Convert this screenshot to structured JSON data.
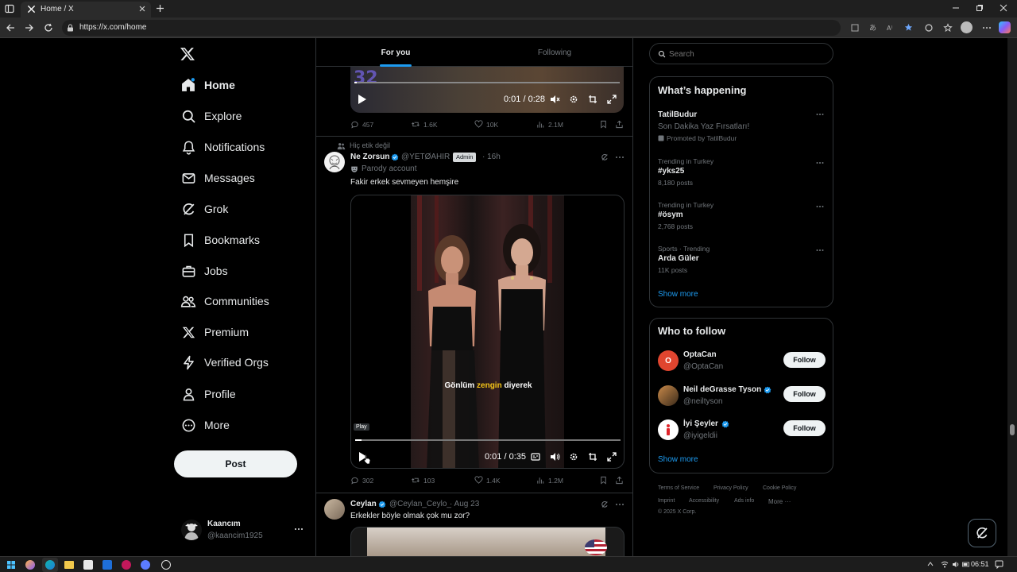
{
  "browser": {
    "tab_title": "Home / X",
    "url": "https://x.com/home"
  },
  "nav": {
    "items": [
      {
        "label": "Home",
        "icon": "home-icon",
        "active": true
      },
      {
        "label": "Explore",
        "icon": "search-icon"
      },
      {
        "label": "Notifications",
        "icon": "bell-icon"
      },
      {
        "label": "Messages",
        "icon": "envelope-icon"
      },
      {
        "label": "Grok",
        "icon": "grok-icon"
      },
      {
        "label": "Bookmarks",
        "icon": "bookmark-icon"
      },
      {
        "label": "Jobs",
        "icon": "briefcase-icon"
      },
      {
        "label": "Communities",
        "icon": "people-icon"
      },
      {
        "label": "Premium",
        "icon": "x-logo-icon"
      },
      {
        "label": "Verified Orgs",
        "icon": "lightning-icon"
      },
      {
        "label": "Profile",
        "icon": "person-icon"
      },
      {
        "label": "More",
        "icon": "more-circle-icon"
      }
    ],
    "post_label": "Post",
    "account": {
      "name": "Kaancım",
      "handle": "@kaancim1925"
    }
  },
  "feed": {
    "tabs": [
      {
        "label": "For you",
        "active": true
      },
      {
        "label": "Following",
        "active": false
      }
    ],
    "tweet0": {
      "video_watermark": "32",
      "time": "0:01 / 0:28",
      "replies": "457",
      "reposts": "1.6K",
      "likes": "10K",
      "views": "2.1M"
    },
    "tweet1": {
      "social_context": "Hiç etik değil",
      "name": "Ne Zorsun",
      "handle": "@YETØAHIR",
      "badge": "Admin",
      "ago": "· 16h",
      "parody": "Parody account",
      "text": "Fakir erkek sevmeyen hemşire",
      "subtitle_a": "Gönlüm ",
      "subtitle_b": "zengin",
      "subtitle_c": " diyerek",
      "tooltip": "Play",
      "time": "0:01 / 0:35",
      "replies": "302",
      "reposts": "103",
      "likes": "1.4K",
      "views": "1.2M"
    },
    "tweet2": {
      "name": "Ceylan",
      "handle": "@Ceylan_Ceylo_",
      "ago": "· Aug 23",
      "text": "Erkekler böyle olmak çok mu zor?"
    }
  },
  "right": {
    "search_placeholder": "Search",
    "happening": {
      "title": "What’s happening",
      "trends": [
        {
          "title": "TatilBudur",
          "sub": "Son Dakika Yaz Fırsatları!",
          "meta": "Promoted by TatilBudur"
        },
        {
          "meta": "Trending in Turkey",
          "title": "#yks25",
          "posts": "8,180 posts"
        },
        {
          "meta": "Trending in Turkey",
          "title": "#ösym",
          "posts": "2,768 posts"
        },
        {
          "meta": "Sports · Trending",
          "title": "Arda Güler",
          "posts": "11K posts"
        }
      ],
      "show_more": "Show more"
    },
    "who": {
      "title": "Who to follow",
      "users": [
        {
          "name": "OptaCan",
          "handle": "@OptaCan"
        },
        {
          "name": "Neil deGrasse Tyson",
          "handle": "@neiltyson"
        },
        {
          "name": "İyi Şeyler",
          "handle": "@iyigeldii"
        }
      ],
      "follow_label": "Follow",
      "show_more": "Show more"
    },
    "footer": {
      "links": [
        "Terms of Service",
        "Privacy Policy",
        "Cookie Policy",
        "Imprint",
        "Accessibility",
        "Ads info",
        "More ···"
      ],
      "copyright": "© 2025 X Corp."
    }
  },
  "taskbar": {
    "clock": "06:51"
  }
}
